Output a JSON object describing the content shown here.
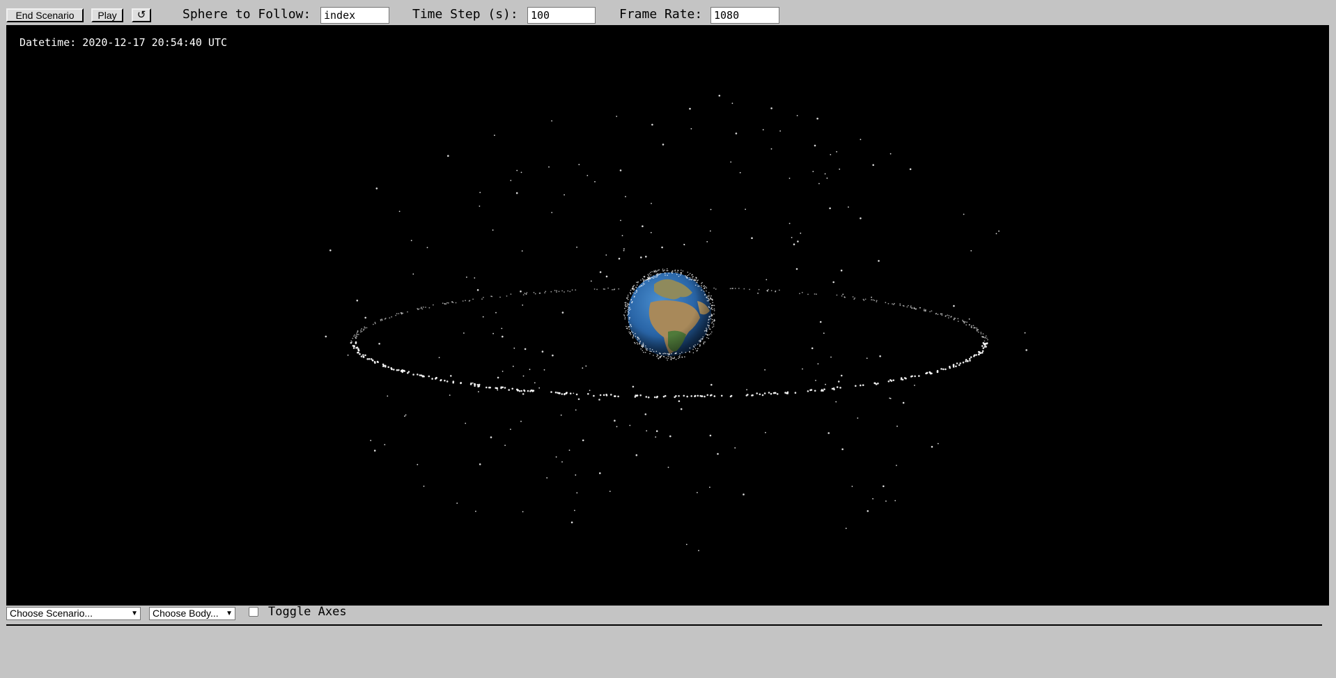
{
  "toolbar": {
    "end_scenario_label": "End Scenario",
    "play_label": "Play",
    "reset_symbol": "↺",
    "sphere_label": "Sphere to Follow:",
    "sphere_value": "index",
    "timestep_label": "Time Step (s):",
    "timestep_value": "100",
    "framerate_label": "Frame Rate:",
    "framerate_value": "1080"
  },
  "viewport": {
    "datetime": "Datetime: 2020-12-17 20:54:40 UTC",
    "background_color": "#000000",
    "earth_icon": "earth-globe",
    "satellite_color": "#ffffff"
  },
  "bottom": {
    "scenario_select": "Choose Scenario...",
    "body_select": "Choose Body...",
    "toggle_axes_label": "Toggle Axes",
    "toggle_axes_checked": false
  },
  "colors": {
    "chrome_background": "#c4c4c4",
    "ocean": "#2f6fb0",
    "land": "#8d7a4f"
  }
}
